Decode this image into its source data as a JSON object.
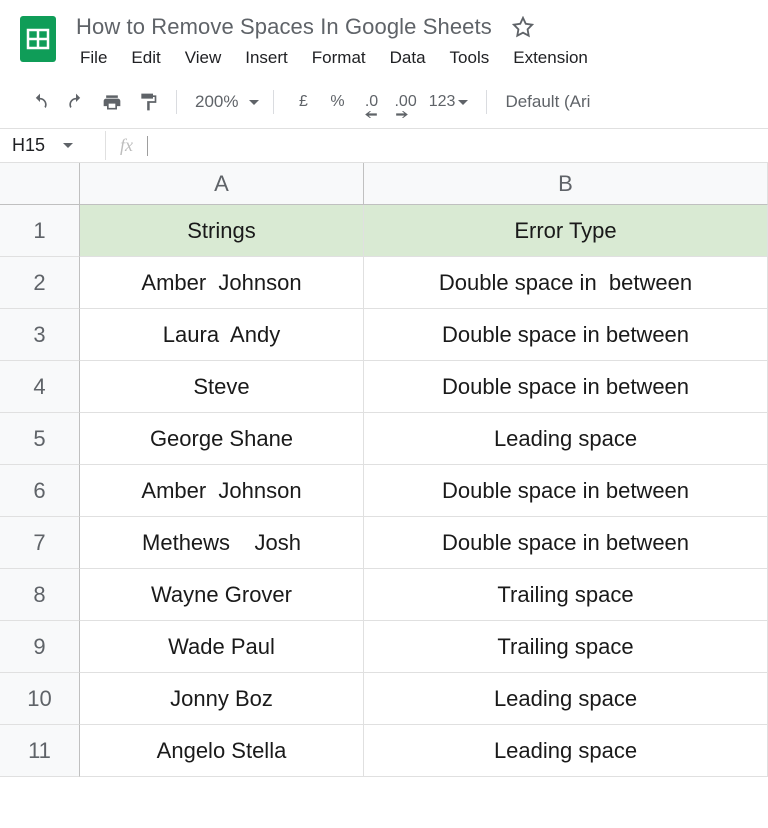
{
  "doc_title": "How to Remove Spaces In Google Sheets",
  "menus": [
    "File",
    "Edit",
    "View",
    "Insert",
    "Format",
    "Data",
    "Tools",
    "Extension"
  ],
  "toolbar": {
    "zoom": "200%",
    "currency": "£",
    "percent": "%",
    "dec_dec": ".0",
    "inc_dec": ".00",
    "more_fmt": "123",
    "font": "Default (Ari"
  },
  "namebox": "H15",
  "fx_label": "fx",
  "formula_value": "",
  "columns": [
    "A",
    "B"
  ],
  "rows": [
    {
      "n": "1",
      "a": "Strings",
      "b": "Error Type",
      "hdr": true
    },
    {
      "n": "2",
      "a": "Amber  Johnson",
      "b": "Double space in  between"
    },
    {
      "n": "3",
      "a": "Laura  Andy",
      "b": "Double space in between"
    },
    {
      "n": "4",
      "a": "Steve",
      "b": "Double space in between"
    },
    {
      "n": "5",
      "a": "George Shane",
      "b": "Leading space"
    },
    {
      "n": "6",
      "a": "Amber  Johnson",
      "b": "Double space in between"
    },
    {
      "n": "7",
      "a": "Methews    Josh",
      "b": "Double space in between"
    },
    {
      "n": "8",
      "a": "Wayne Grover",
      "b": "Trailing space"
    },
    {
      "n": "9",
      "a": "Wade Paul",
      "b": "Trailing space"
    },
    {
      "n": "10",
      "a": "Jonny Boz",
      "b": "Leading space"
    },
    {
      "n": "11",
      "a": "Angelo Stella",
      "b": "Leading space"
    }
  ]
}
